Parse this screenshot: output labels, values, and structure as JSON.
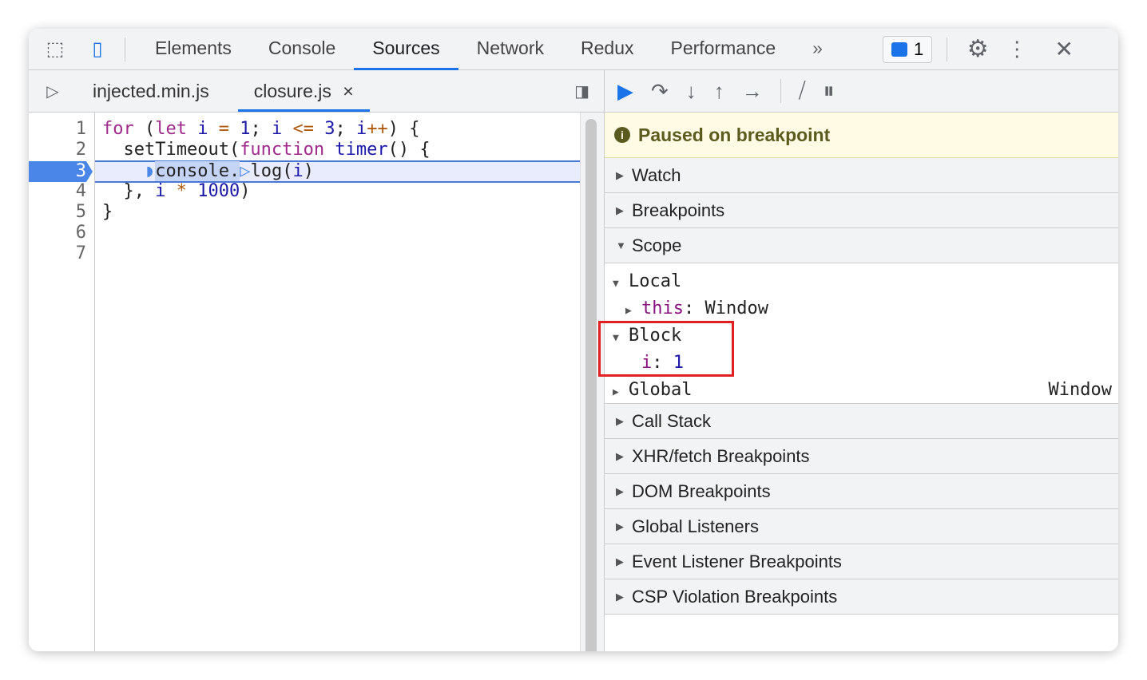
{
  "toolbar": {
    "tabs": [
      "Elements",
      "Console",
      "Sources",
      "Network",
      "Redux",
      "Performance"
    ],
    "active": "Sources",
    "more": "»",
    "issues_count": "1"
  },
  "files": {
    "tabs": [
      "injected.min.js",
      "closure.js"
    ],
    "active": "closure.js",
    "close": "×"
  },
  "code": {
    "line_numbers": [
      "1",
      "2",
      "3",
      "4",
      "5",
      "6",
      "7"
    ],
    "current_line": "3"
  },
  "debugger": {
    "paused": "Paused on breakpoint",
    "sections_top": [
      "Watch",
      "Breakpoints",
      "Scope"
    ],
    "scope": {
      "local": "Local",
      "this_key": "this",
      "this_val": "Window",
      "block": "Block",
      "i_key": "i",
      "i_val": "1",
      "global": "Global",
      "global_val": "Window"
    },
    "sections_bottom": [
      "Call Stack",
      "XHR/fetch Breakpoints",
      "DOM Breakpoints",
      "Global Listeners",
      "Event Listener Breakpoints",
      "CSP Violation Breakpoints"
    ]
  },
  "colors": {
    "accent": "#1a73e8",
    "highlight": "#e8ecfc",
    "annotation": "#e02020"
  }
}
